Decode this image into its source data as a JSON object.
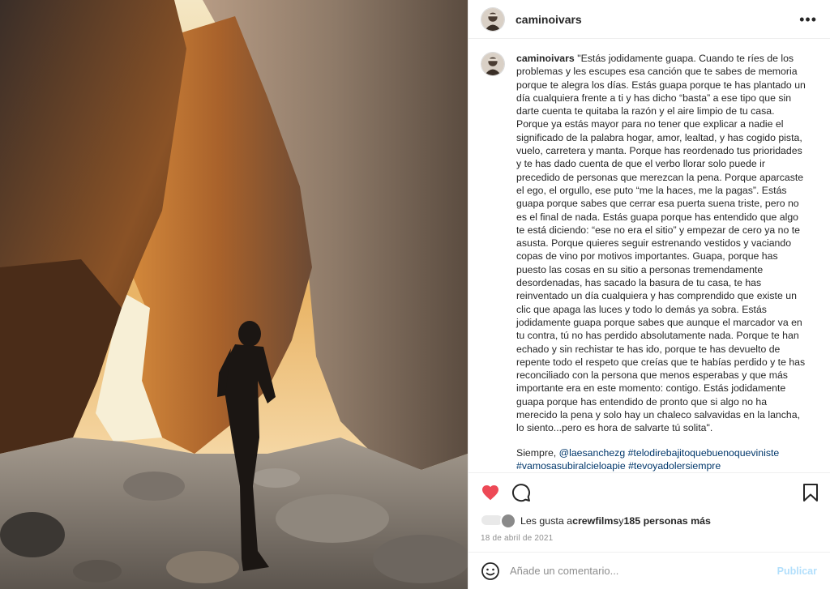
{
  "post": {
    "username": "caminoivars",
    "more_icon": "more-dots-icon",
    "caption": {
      "username": "caminoivars",
      "text": "\"Estás jodidamente guapa. Cuando te ríes de los problemas y les escupes esa canción que te sabes de memoria porque te alegra los días. Estás guapa porque te has plantado un día cualquiera frente a ti y has dicho “basta” a ese tipo que sin darte cuenta te quitaba la razón y el aire limpio de tu casa. Porque ya estás mayor para no tener que explicar a nadie el significado de la palabra hogar, amor, lealtad, y has cogido pista, vuelo, carretera y manta. Porque has reordenado tus prioridades y te has dado cuenta de que el verbo llorar solo puede ir precedido de personas que merezcan la pena. Porque aparcaste el ego, el orgullo, ese puto “me la haces, me la pagas”. Estás guapa porque sabes que cerrar esa puerta suena triste, pero no es el final de nada. Estás guapa porque has entendido que algo te está diciendo: “ese no era el sitio” y empezar de cero ya no te asusta. Porque quieres seguir estrenando vestidos y vaciando copas de vino por motivos importantes. Guapa, porque has puesto las cosas en su sitio a personas tremendamente desordenadas, has sacado la basura de tu casa, te has reinventado un día cualquiera y has comprendido que existe un clic que apaga las luces y todo lo demás ya sobra. Estás jodidamente guapa porque sabes que aunque el marcador va en tu contra, tú no has perdido absolutamente nada. Porque te han echado y sin rechistar te has ido, porque te has devuelto de repente todo el respeto que creías que te habías perdido y te has reconciliado con la persona que menos esperabas y que más importante era en este momento: contigo. Estás jodidamente guapa porque has entendido de pronto que si algo no ha merecido la pena y solo hay un chaleco salvavidas en la lancha, lo siento...pero es hora de salvarte tú solita\".",
      "thanks_prefix": "Siempre, ",
      "mention_1": "@laesanchezg",
      "hashtag_1": "#telodirebajitoquebuenoqueviniste",
      "hashtag_2": "#vamosasubiralcieloapie",
      "hashtag_3": "#tevoyadolersiempre"
    },
    "likes": {
      "prefix": "Les gusta a ",
      "user": "crewfilms",
      "middle": " y ",
      "count": "185 personas más"
    },
    "date": "18 de abril de 2021",
    "comment_input_placeholder": "Añade un comentario...",
    "publish_label": "Publicar",
    "colors": {
      "like_heart": "#ed4956",
      "mention": "#00376b",
      "publish_disabled": "#b2dffc",
      "date_gray": "#8e8e8e"
    },
    "icons": [
      "heart-filled-icon",
      "comment-bubble-icon",
      "bookmark-icon",
      "emoji-icon"
    ]
  }
}
